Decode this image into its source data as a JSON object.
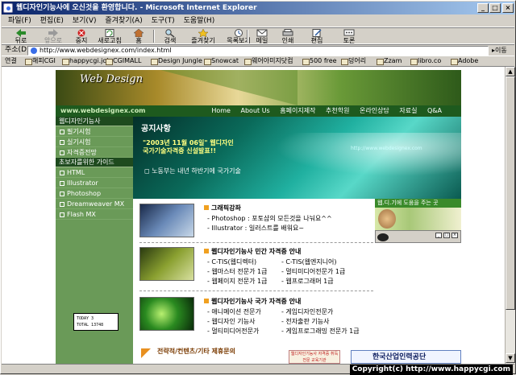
{
  "window": {
    "title": "웹디자인기능사에 오신것을 환영합니다. - Microsoft Internet Explorer"
  },
  "menu": [
    "파일(F)",
    "편집(E)",
    "보기(V)",
    "즐겨찾기(A)",
    "도구(T)",
    "도움말(H)"
  ],
  "toolbar": [
    {
      "label": "뒤로",
      "icon": "back-icon"
    },
    {
      "label": "앞으로",
      "icon": "forward-icon"
    },
    {
      "label": "중지",
      "icon": "stop-icon"
    },
    {
      "label": "새로고침",
      "icon": "refresh-icon"
    },
    {
      "label": "홈",
      "icon": "home-icon"
    },
    {
      "label": "검색",
      "icon": "search-icon"
    },
    {
      "label": "즐겨찾기",
      "icon": "favorites-icon"
    },
    {
      "label": "목록보기",
      "icon": "history-icon"
    },
    {
      "label": "메일",
      "icon": "mail-icon"
    },
    {
      "label": "인쇄",
      "icon": "print-icon"
    },
    {
      "label": "편집",
      "icon": "edit-icon"
    },
    {
      "label": "토론",
      "icon": "discuss-icon"
    }
  ],
  "address": {
    "label": "주소(D)",
    "url": "http://www.webdesignex.com/index.html",
    "go": "이동"
  },
  "links": {
    "label": "연결",
    "items": [
      "해피CGI",
      "happycgi.job",
      "CGIMALL",
      "Design Jungle",
      "Snowcat",
      "웨어아미지닷컴",
      "500 free",
      "덩어리",
      "Zzam",
      "libro.co",
      "Adobe"
    ]
  },
  "site": {
    "logo": "Web Design",
    "url": "www.webdesignex.com",
    "nav": [
      "Home",
      "About Us",
      "홈페이지제작",
      "추천학원",
      "온라인상담",
      "자료실",
      "Q&A"
    ],
    "sidebar": [
      {
        "cat": "웹디자인기능사",
        "items": [
          "필기시험",
          "실기시험",
          "자격증전망"
        ]
      },
      {
        "cat": "초보자를위한 가이드",
        "items": [
          "HTML",
          "Illustrator",
          "Photoshop",
          "Dreamweaver MX",
          "Flash MX"
        ]
      }
    ],
    "counter": {
      "today": "TODAY    3",
      "total": "TOTAL  13748"
    },
    "hero": {
      "title": "공지사항",
      "notice1": "\"2003년 11월 06일\" 웹디자인",
      "notice2": "국가기술자격증 신설발표!!",
      "notice3": "노동부는 내년 하반기에 국가기술",
      "site": "http://www.webdesignex.com"
    },
    "sections": [
      {
        "title": "그래픽강좌",
        "lines": [
          "- Photoshop : 포토샵의 모든것을 나눠요^^",
          "- Illustrator : 일러스트를 배워요~"
        ]
      },
      {
        "title": "웹디자인기능사 민간 자격증 안내",
        "col1": [
          "- C-TIS(웹디렉터)",
          "- 웹마스터 전문가 1급",
          "- 웹페이지 전문가 1급"
        ],
        "col2": [
          "- C-TIS(웹엔지니어)",
          "- 멀티미디어전문가 1급",
          "- 웹프로그래머 1급"
        ]
      },
      {
        "title": "웹디자인기능사 국가 자격증 안내",
        "col1": [
          "- 애니메이션 전문가",
          "- 웹디자인 기능사",
          "- 멀티미디어전문가"
        ],
        "col2": [
          "- 게임디자인전문가",
          "- 전자출판 기능사",
          "- 게임프로그래밍 전문가 1급"
        ]
      }
    ],
    "right": {
      "title": "웹.디.기에 도움을 주는 곳"
    },
    "bottom": {
      "left": "전략적/컨텐츠/기타 제휴문의",
      "middle": "웹디자인기능사 자격증 취득\n전문 교육기관",
      "right": "한국산업인력공단"
    }
  },
  "status": {
    "copyright": "Copyright(c) http://www.happycgi.com"
  }
}
